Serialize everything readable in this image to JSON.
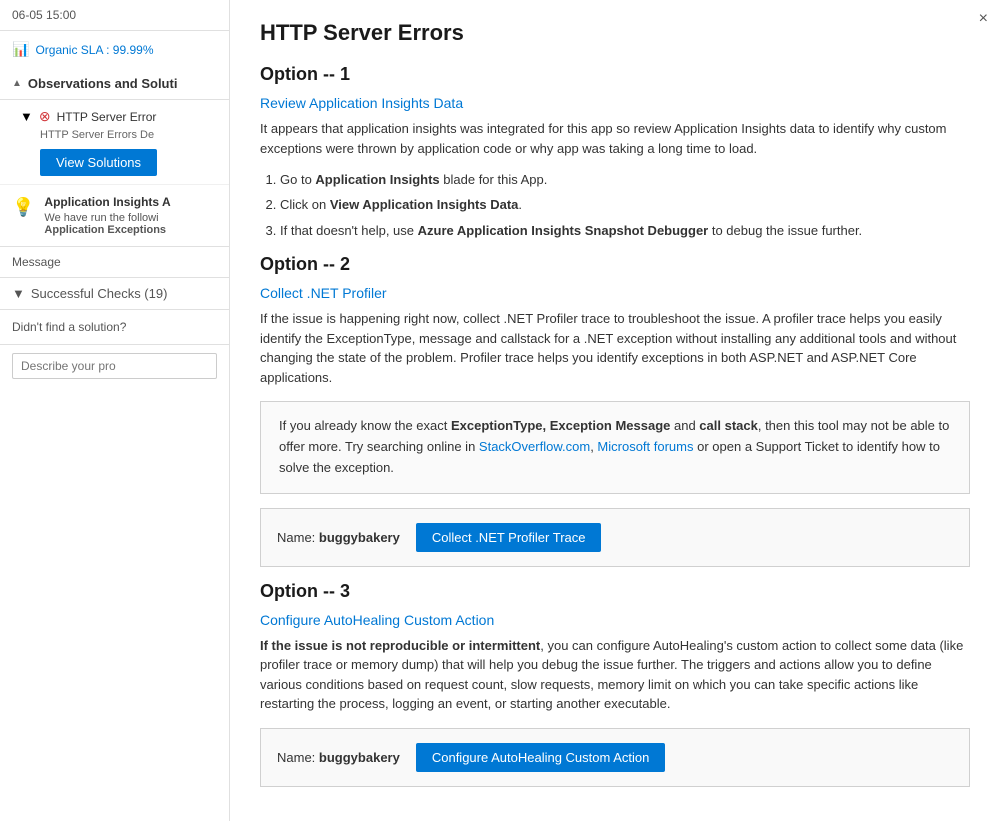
{
  "left": {
    "header": "06-05 15:00",
    "sla_icon": "📊",
    "sla_text": "Organic SLA : 99.99%",
    "observations_title": "Observations and Soluti",
    "obs_item_title": "HTTP Server Error",
    "obs_item_desc": "HTTP Server Errors De",
    "view_solutions_label": "View Solutions",
    "bulb_icon": "💡",
    "app_insights_title": "Application Insights A",
    "app_insights_desc_prefix": "We have run the followi",
    "app_insights_bold": "Application Exceptions",
    "message_label": "Message",
    "successful_checks": "Successful Checks (19)",
    "didnt_find": "Didn't find a solution?",
    "describe_placeholder": "Describe your pro"
  },
  "right": {
    "close_label": "×",
    "main_title": "HTTP Server Errors",
    "option1": {
      "title": "Option -- 1",
      "subtitle": "Review Application Insights Data",
      "desc": "It appears that application insights was integrated for this app so review Application Insights data to identify why custom exceptions were thrown by application code or why app was taking a long time to load.",
      "steps": [
        {
          "text": "Go to ",
          "bold": "Application Insights",
          "after": " blade for this App."
        },
        {
          "text": "Click on ",
          "bold": "View Application Insights Data",
          "after": "."
        },
        {
          "text": "If that doesn't help, use ",
          "bold": "Azure Application Insights Snapshot Debugger",
          "after": " to debug the issue further."
        }
      ]
    },
    "option2": {
      "title": "Option -- 2",
      "subtitle": "Collect .NET Profiler",
      "desc": "If the issue is happening right now, collect .NET Profiler trace to troubleshoot the issue. A profiler trace helps you easily identify the ExceptionType, message and callstack for a .NET exception without installing any additional tools and without changing the state of the problem. Profiler trace helps you identify exceptions in both ASP.NET and ASP.NET Core applications.",
      "infobox": {
        "prefix": "If you already know the exact ",
        "bold1": "ExceptionType, Exception Message",
        "mid1": " and ",
        "bold2": "call stack",
        "mid2": ", then this tool may not be able to offer more. Try searching online in ",
        "link1": "StackOverflow.com",
        "mid3": ", ",
        "link2": "Microsoft forums",
        "suffix": " or open a Support Ticket to identify how to solve the exception."
      },
      "name_label": "Name:",
      "name_value": "buggybakery",
      "action_label": "Collect .NET Profiler Trace"
    },
    "option3": {
      "title": "Option -- 3",
      "subtitle": "Configure AutoHealing Custom Action",
      "desc_bold": "If the issue is not reproducible or intermittent",
      "desc_after": ", you can configure AutoHealing's custom action to collect some data (like profiler trace or memory dump) that will help you debug the issue further. The triggers and actions allow you to define various conditions based on request count, slow requests, memory limit on which you can take specific actions like restarting the process, logging an event, or starting another executable.",
      "name_label": "Name:",
      "name_value": "buggybakery",
      "action_label": "Configure AutoHealing Custom Action"
    }
  }
}
